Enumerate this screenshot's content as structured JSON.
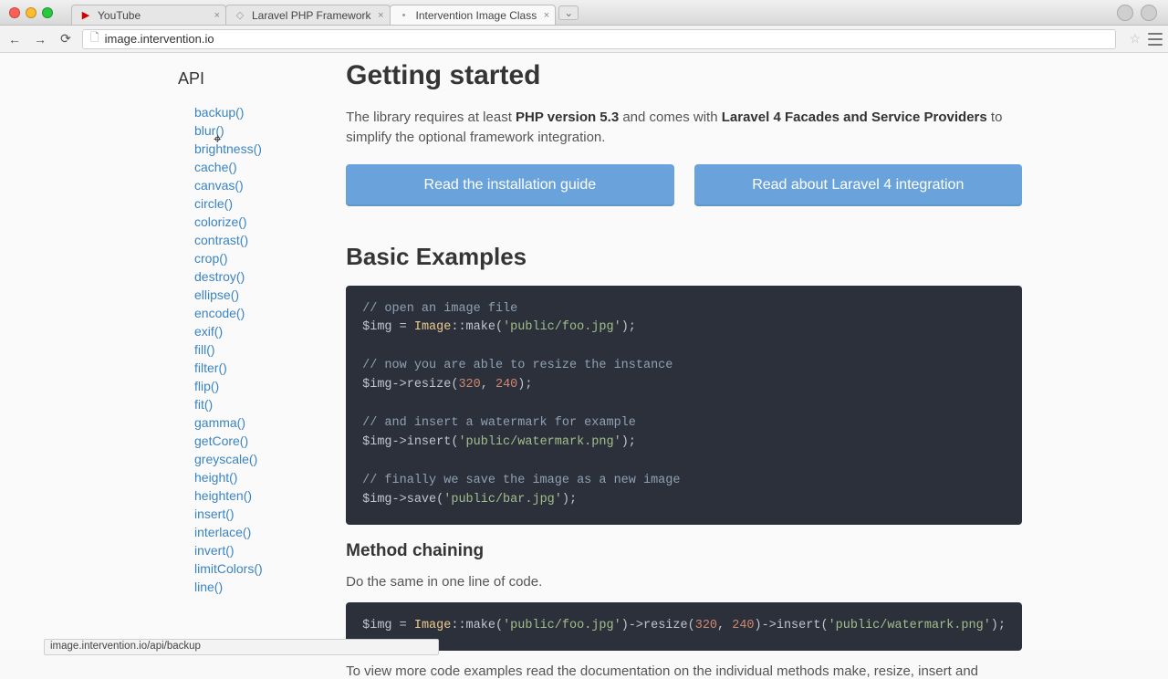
{
  "browser": {
    "tabs": [
      {
        "title": "YouTube",
        "active": false,
        "fav": "▶"
      },
      {
        "title": "Laravel PHP Framework",
        "active": false,
        "fav": "◇"
      },
      {
        "title": "Intervention Image Class",
        "active": true,
        "fav": "•"
      }
    ],
    "url": "image.intervention.io"
  },
  "sidebar": {
    "heading": "API",
    "items": [
      "backup()",
      "blur()",
      "brightness()",
      "cache()",
      "canvas()",
      "circle()",
      "colorize()",
      "contrast()",
      "crop()",
      "destroy()",
      "ellipse()",
      "encode()",
      "exif()",
      "fill()",
      "filter()",
      "flip()",
      "fit()",
      "gamma()",
      "getCore()",
      "greyscale()",
      "height()",
      "heighten()",
      "insert()",
      "interlace()",
      "invert()",
      "limitColors()",
      "line()"
    ]
  },
  "content": {
    "h1": "Getting started",
    "lead_pre": "The library requires at least ",
    "php_ver": "PHP version 5.3",
    "lead_mid": " and comes with ",
    "laravel": "Laravel 4 Facades and Service Providers",
    "lead_post": " to simplify the optional framework integration.",
    "btn1": "Read the installation guide",
    "btn2": "Read about Laravel 4 integration",
    "h2": "Basic Examples",
    "code1": {
      "l1": "// open an image file",
      "l2a": "$img = ",
      "l2b": "Image",
      "l2c": "::make(",
      "l2d": "'public/foo.jpg'",
      "l2e": ");",
      "l3": "// now you are able to resize the instance",
      "l4a": "$img->resize(",
      "l4b": "320",
      "l4c": ", ",
      "l4d": "240",
      "l4e": ");",
      "l5": "// and insert a watermark for example",
      "l6a": "$img->insert(",
      "l6b": "'public/watermark.png'",
      "l6c": ");",
      "l7": "// finally we save the image as a new image",
      "l8a": "$img->save(",
      "l8b": "'public/bar.jpg'",
      "l8c": ");"
    },
    "h3": "Method chaining",
    "para1": "Do the same in one line of code.",
    "code2": {
      "a": "$img = ",
      "b": "Image",
      "c": "::make(",
      "d": "'public/foo.jpg'",
      "e": ")->resize(",
      "f": "320",
      "g": ", ",
      "h": "240",
      "i": ")->insert(",
      "j": "'public/watermark.png'",
      "k": ");"
    },
    "para2": "To view more code examples read the documentation on the individual methods make, resize, insert and"
  },
  "status": "image.intervention.io/api/backup"
}
